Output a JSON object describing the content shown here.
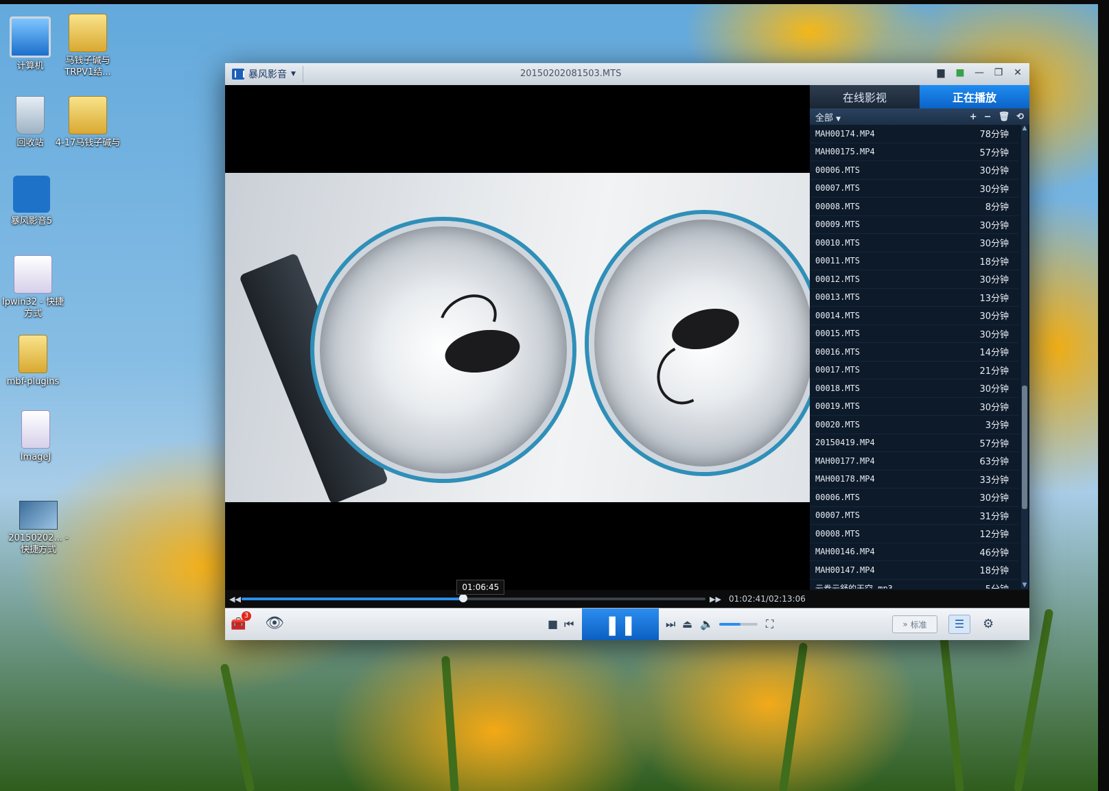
{
  "desktop": {
    "icons": [
      {
        "label": "计算机",
        "icon": "computer-icon"
      },
      {
        "label": "马钱子碱与TRPV1结...",
        "icon": "folder-icon"
      },
      {
        "label": "回收站",
        "icon": "recycle-bin-icon"
      },
      {
        "label": "4-17马钱子碱与",
        "icon": "folder-icon"
      },
      {
        "label": "暴风影音5",
        "icon": "player-app-icon"
      },
      {
        "label": "Ipwin32 - 快捷方式",
        "icon": "microscope-icon"
      },
      {
        "label": "mbf-plugins",
        "icon": "folder-icon"
      },
      {
        "label": "ImageJ",
        "icon": "microscope-icon"
      },
      {
        "label": "20150202... - 快捷方式",
        "icon": "video-shortcut-icon"
      }
    ]
  },
  "player": {
    "brand": "暴风影音",
    "title": "20150202081503.MTS",
    "tabs": [
      {
        "label": "在线影视",
        "active": false
      },
      {
        "label": "正在播放",
        "active": true
      }
    ],
    "filter_label": "全部",
    "playlist": [
      {
        "name": "MAH00174.MP4",
        "duration": "78分钟"
      },
      {
        "name": "MAH00175.MP4",
        "duration": "57分钟"
      },
      {
        "name": "00006.MTS",
        "duration": "30分钟"
      },
      {
        "name": "00007.MTS",
        "duration": "30分钟"
      },
      {
        "name": "00008.MTS",
        "duration": "8分钟"
      },
      {
        "name": "00009.MTS",
        "duration": "30分钟"
      },
      {
        "name": "00010.MTS",
        "duration": "30分钟"
      },
      {
        "name": "00011.MTS",
        "duration": "18分钟"
      },
      {
        "name": "00012.MTS",
        "duration": "30分钟"
      },
      {
        "name": "00013.MTS",
        "duration": "13分钟"
      },
      {
        "name": "00014.MTS",
        "duration": "30分钟"
      },
      {
        "name": "00015.MTS",
        "duration": "30分钟"
      },
      {
        "name": "00016.MTS",
        "duration": "14分钟"
      },
      {
        "name": "00017.MTS",
        "duration": "21分钟"
      },
      {
        "name": "00018.MTS",
        "duration": "30分钟"
      },
      {
        "name": "00019.MTS",
        "duration": "30分钟"
      },
      {
        "name": "00020.MTS",
        "duration": "3分钟"
      },
      {
        "name": "20150419.MP4",
        "duration": "57分钟"
      },
      {
        "name": "MAH00177.MP4",
        "duration": "63分钟"
      },
      {
        "name": "MAH00178.MP4",
        "duration": "33分钟"
      },
      {
        "name": "00006.MTS",
        "duration": "30分钟"
      },
      {
        "name": "00007.MTS",
        "duration": "31分钟"
      },
      {
        "name": "00008.MTS",
        "duration": "12分钟"
      },
      {
        "name": "MAH00146.MP4",
        "duration": "46分钟"
      },
      {
        "name": "MAH00147.MP4",
        "duration": "18分钟"
      },
      {
        "name": "云卷云舒的天空.mp3",
        "duration": "5分钟"
      }
    ],
    "hover_time": "01:06:45",
    "timecode": "01:02:41/02:13:06",
    "progress_fraction": 0.478,
    "hover_fraction": 0.508,
    "volume_fraction": 0.55,
    "notification_count": "3",
    "standard_label": "标准",
    "accent_color": "#2b8ef0"
  }
}
